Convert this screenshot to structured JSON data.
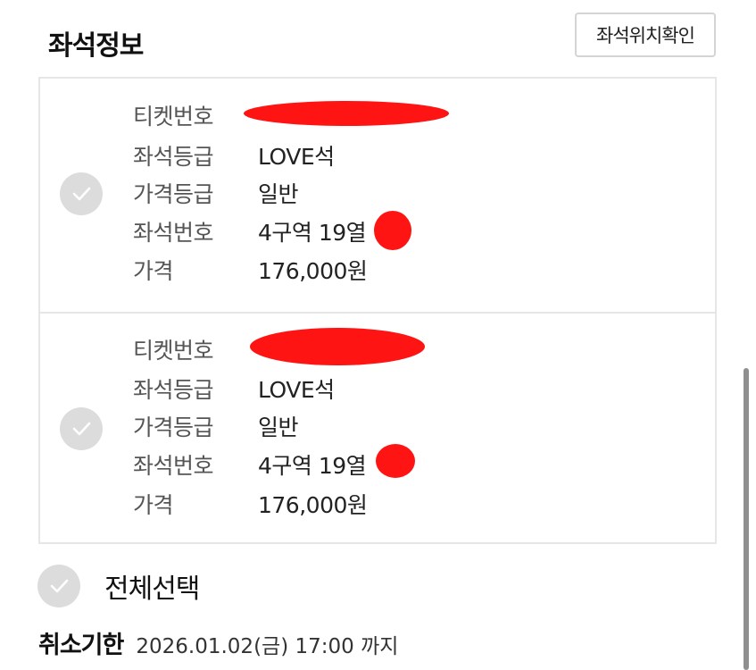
{
  "header": {
    "title": "좌석정보",
    "seat_map_button": "좌석위치확인"
  },
  "tickets": [
    {
      "rows": [
        {
          "label": "티켓번호",
          "value": ""
        },
        {
          "label": "좌석등급",
          "value": "LOVE석"
        },
        {
          "label": "가격등급",
          "value": "일반"
        },
        {
          "label": "좌석번호",
          "value": "4구역 19열"
        },
        {
          "label": "가격",
          "value": "176,000원"
        }
      ]
    },
    {
      "rows": [
        {
          "label": "티켓번호",
          "value": ""
        },
        {
          "label": "좌석등급",
          "value": "LOVE석"
        },
        {
          "label": "가격등급",
          "value": "일반"
        },
        {
          "label": "좌석번호",
          "value": "4구역 19열"
        },
        {
          "label": "가격",
          "value": "176,000원"
        }
      ]
    }
  ],
  "select_all": {
    "label": "전체선택"
  },
  "deadline": {
    "label": "취소기한",
    "value": "2026.01.02(금) 17:00 까지"
  },
  "colors": {
    "check_bg": "#dcdcdc",
    "redaction": "#ff1414",
    "border": "#e6e6e6"
  }
}
